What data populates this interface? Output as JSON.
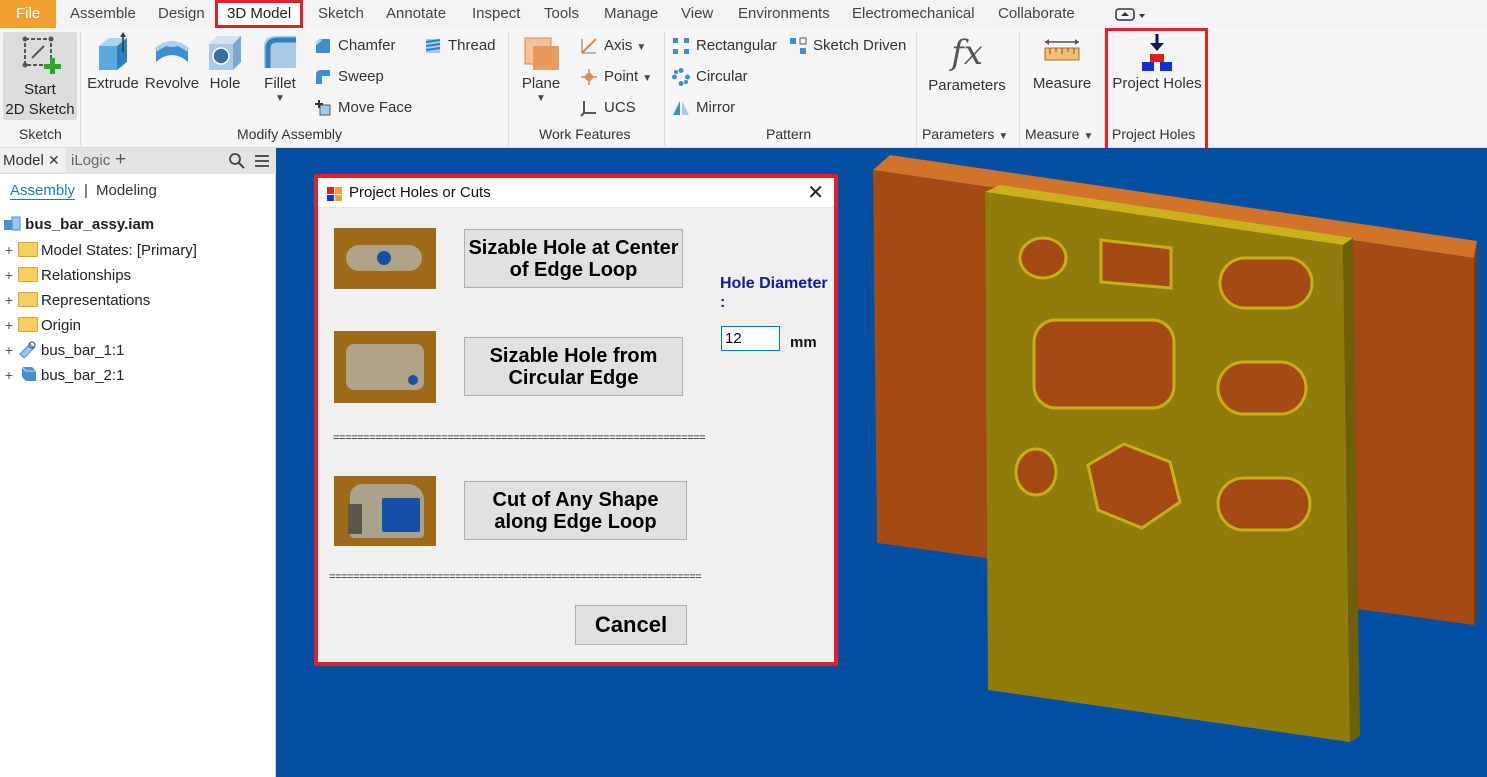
{
  "tabs": [
    {
      "label": "File"
    },
    {
      "label": "Assemble"
    },
    {
      "label": "Design"
    },
    {
      "label": "3D Model"
    },
    {
      "label": "Sketch"
    },
    {
      "label": "Annotate"
    },
    {
      "label": "Inspect"
    },
    {
      "label": "Tools"
    },
    {
      "label": "Manage"
    },
    {
      "label": "View"
    },
    {
      "label": "Environments"
    },
    {
      "label": "Electromechanical"
    },
    {
      "label": "Collaborate"
    }
  ],
  "ribbon": {
    "sketch": {
      "start_line1": "Start",
      "start_line2": "2D Sketch",
      "panel_title": "Sketch"
    },
    "modify": {
      "extrude": "Extrude",
      "revolve": "Revolve",
      "hole": "Hole",
      "fillet": "Fillet",
      "chamfer": "Chamfer",
      "thread": "Thread",
      "sweep": "Sweep",
      "move_face": "Move Face",
      "panel_title": "Modify Assembly"
    },
    "work": {
      "plane": "Plane",
      "axis": "Axis",
      "point": "Point",
      "ucs": "UCS",
      "panel_title": "Work Features"
    },
    "pattern": {
      "rectangular": "Rectangular",
      "sketch_driven": "Sketch Driven",
      "circular": "Circular",
      "mirror": "Mirror",
      "panel_title": "Pattern"
    },
    "parameters": {
      "button": "Parameters",
      "panel_title": "Parameters"
    },
    "measure": {
      "button": "Measure",
      "panel_title": "Measure"
    },
    "project_holes": {
      "button": "Project Holes",
      "panel_title": "Project Holes"
    }
  },
  "browser": {
    "tab_model": "Model",
    "tab_ilogic": "iLogic",
    "mode_assembly": "Assembly",
    "mode_modeling": "Modeling",
    "root": "bus_bar_assy.iam",
    "items": [
      {
        "label": "Model States: [Primary]"
      },
      {
        "label": "Relationships"
      },
      {
        "label": "Representations"
      },
      {
        "label": "Origin"
      },
      {
        "label": "bus_bar_1:1"
      },
      {
        "label": "bus_bar_2:1"
      }
    ]
  },
  "dialog": {
    "title": "Project Holes or Cuts",
    "btn1": "Sizable Hole at Center of Edge Loop",
    "btn2": "Sizable Hole from Circular Edge",
    "btn3": "Cut of Any Shape along Edge Loop",
    "cancel": "Cancel",
    "hole_diameter_label": "Hole Diameter :",
    "hole_diameter_value": "12",
    "unit": "mm",
    "separator": "=============================================================="
  },
  "colors": {
    "accent_red": "#e0202a",
    "file_tab": "#f0a030",
    "viewport_bg": "#044fa1",
    "copper": "#a24a16",
    "brass": "#8f7c0d"
  }
}
